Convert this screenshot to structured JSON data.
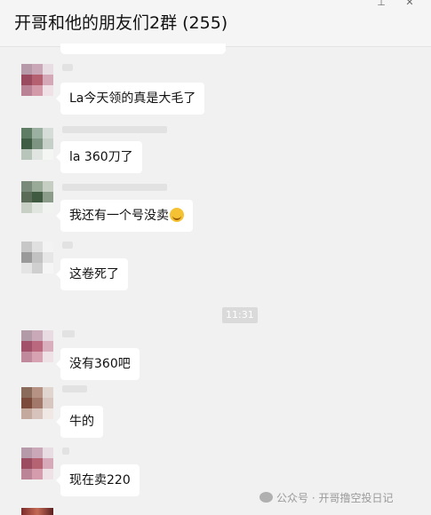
{
  "window": {
    "title": "开哥和他的朋友们2群 (255)",
    "pin_icon": "pin-icon",
    "close_icon": "close-icon"
  },
  "messages": [
    {
      "text": "La今天领的真是大毛了",
      "avatar_colors": [
        "#b69aa9",
        "#c9a7b6",
        "#e7dde3",
        "#9a4a5f",
        "#b46070",
        "#d5a8b8",
        "#ba8295",
        "#d39aaa",
        "#efe1e6"
      ]
    },
    {
      "text": "la 360刀了",
      "avatar_colors": [
        "#5f7d64",
        "#9bb0a0",
        "#d6ddd8",
        "#3f5c44",
        "#7c9481",
        "#c6d0c8",
        "#b8c5bb",
        "#e0e5e1",
        "#f4f6f4"
      ]
    },
    {
      "text": "我还有一个号没卖",
      "emoji": "grinning-emoji",
      "avatar_colors": [
        "#7a8a7a",
        "#9aaa98",
        "#c6cec4",
        "#5a6b57",
        "#3f5a40",
        "#8c9c8a",
        "#c8d0c6",
        "#e2e6e1",
        "#f1f3f0"
      ]
    },
    {
      "text": "这卷死了",
      "avatar_colors": [
        "#c7c7c7",
        "#e0e0e0",
        "#f3f3f3",
        "#9a9a9a",
        "#c2c2c2",
        "#e6e6e6",
        "#e4e4e4",
        "#cfcfcf",
        "#f5f5f5"
      ]
    },
    {
      "text": "没有360吧",
      "avatar_colors": [
        "#b29aa7",
        "#c9a9b8",
        "#e8dce2",
        "#a1516a",
        "#b9687d",
        "#d9aebd",
        "#c08a9c",
        "#d7a3b3",
        "#efe2e7"
      ]
    },
    {
      "text": "牛的",
      "avatar_colors": [
        "#8a6a5a",
        "#b59284",
        "#e0d5cf",
        "#7c4a3a",
        "#a2786a",
        "#d8c7c0",
        "#c3a99e",
        "#d7c3bb",
        "#efe8e4"
      ]
    },
    {
      "text": "现在卖220",
      "avatar_colors": [
        "#b79aa9",
        "#caa8b7",
        "#e8dde3",
        "#9b4c61",
        "#b56272",
        "#d6aab9",
        "#bb8497",
        "#d49cac",
        "#efe2e7"
      ]
    }
  ],
  "timestamp": "11:31",
  "watermark": {
    "icon": "wechat-official-account-icon",
    "text": "公众号 · 开哥撸空投日记"
  }
}
